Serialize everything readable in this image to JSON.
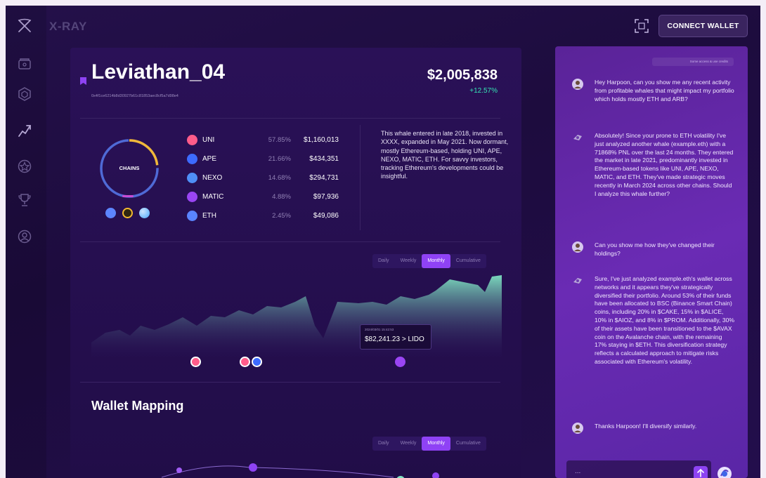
{
  "app": {
    "name": "X-RAY",
    "connect_wallet_label": "CONNECT WALLET"
  },
  "sidebar": {
    "items": [
      {
        "name": "wallet-icon"
      },
      {
        "name": "hexagon-icon"
      },
      {
        "name": "chart-icon"
      },
      {
        "name": "star-badge-icon"
      },
      {
        "name": "trophy-icon"
      },
      {
        "name": "profile-icon"
      }
    ]
  },
  "wallet": {
    "name": "Leviathan_04",
    "address": "0x4f1ce6214b8d30927b61c81853aec8cf5a7d98e4",
    "total_value": "$2,005,838",
    "change": "+12.57%"
  },
  "chains": {
    "label": "CHAINS",
    "coins": [
      {
        "name": "ethereum-coin-icon",
        "color": "#627eea"
      },
      {
        "name": "bnb-coin-icon",
        "color": "#f3ba2f"
      },
      {
        "name": "avalanche-coin-icon",
        "color": "#4aa8ff"
      }
    ]
  },
  "holdings": [
    {
      "token": "UNI",
      "pct": "57.85%",
      "value": "$1,160,013",
      "color": "#ff5c8a"
    },
    {
      "token": "APE",
      "pct": "21.66%",
      "value": "$434,351",
      "color": "#3d6bff"
    },
    {
      "token": "NEXO",
      "pct": "14.68%",
      "value": "$294,731",
      "color": "#4f8ff7"
    },
    {
      "token": "MATIC",
      "pct": "4.88%",
      "value": "$97,936",
      "color": "#9a45f3"
    },
    {
      "token": "ETH",
      "pct": "2.45%",
      "value": "$49,086",
      "color": "#5a85ff"
    }
  ],
  "summary": "This whale entered in late 2018, invested in XXXX, expanded in May 2021. Now dormant, mostly Ethereum-based, holding UNI, APE, NEXO, MATIC, ETH. For savvy investors, tracking Ethereum's developments could be insightful.",
  "range_tabs": [
    "Daily",
    "Weekly",
    "Monthly",
    "Cumulative"
  ],
  "active_range": "Monthly",
  "tooltip": {
    "date": "2024/03/01 15:42:53",
    "value": "$82,241.23 > LIDO"
  },
  "wallet_mapping": {
    "title": "Wallet Mapping"
  },
  "chat": {
    "top_pill": "Some access & use credits",
    "messages": [
      {
        "role": "user",
        "text": "Hey Harpoon, can you show me any recent activity from profitable whales that might impact my portfolio which holds mostly ETH and ARB?"
      },
      {
        "role": "assistant",
        "text": "Absolutely! Since your prone to ETH volatility I've just analyzed another whale (example.eth) with a 71868% PNL over the last 24 months. They entered the market in late 2021, predominantly invested in Ethereum-based tokens like UNI, APE, NEXO, MATIC, and ETH. They've made strategic moves recently in March 2024 across other chains. Should I analyze this whale further?"
      },
      {
        "role": "user",
        "text": "Can you show me how they've changed their holdings?"
      },
      {
        "role": "assistant",
        "text": "Sure, I've just analyzed example.eth's wallet across networks and it appears they've strategically diversified their portfolio. Around 53% of their funds have been allocated to BSC (Binance Smart Chain) coins, including 20% in $CAKE, 15% in $ALICE, 10% in $AIOZ, and 8% in $PROM. Additionally, 30% of their assets have been transitioned to the $AVAX coin on the Avalanche chain, with the remaining 17% staying in $ETH. This diversification strategy reflects a calculated approach to mitigate risks associated with Ethereum's volatility."
      },
      {
        "role": "user",
        "text": "Thanks Harpoon! I'll diversify similarly."
      }
    ],
    "input_placeholder": "..."
  },
  "colors": {
    "accent": "#8f42f5",
    "positive": "#35e4b4",
    "area": "#7fe2c2"
  }
}
